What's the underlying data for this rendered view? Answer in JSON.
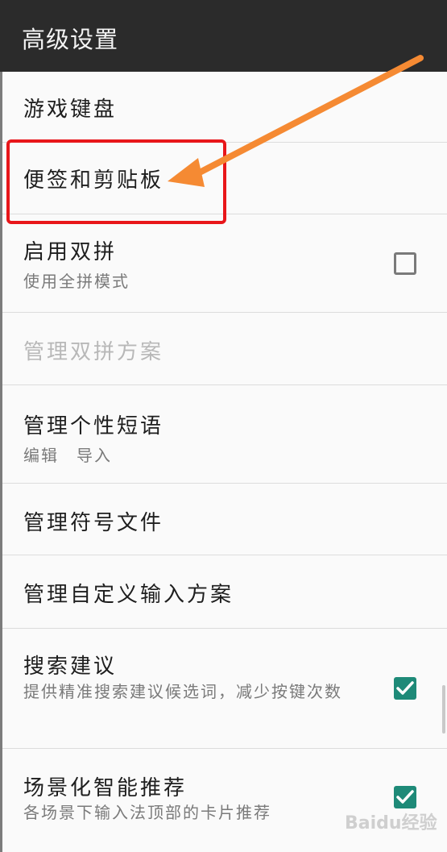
{
  "appbar": {
    "title": "高级设置"
  },
  "items": [
    {
      "title": "游戏键盘"
    },
    {
      "title": "便签和剪贴板"
    },
    {
      "title": "启用双拼",
      "subtitle": "使用全拼模式",
      "checked": false
    },
    {
      "title": "管理双拼方案",
      "disabled": true
    },
    {
      "title": "管理个性短语",
      "subtitle": "编辑　导入"
    },
    {
      "title": "管理符号文件"
    },
    {
      "title": "管理自定义输入方案"
    },
    {
      "title": "搜索建议",
      "subtitle": "提供精准搜索建议候选词，减少按键次数",
      "checked": true
    },
    {
      "title": "场景化智能推荐",
      "subtitle": "各场景下输入法顶部的卡片推荐",
      "checked": true
    }
  ],
  "colors": {
    "accent": "#1e8a78",
    "highlight": "#e8161a",
    "arrow": "#f58a33",
    "appbar": "#2b2b2b"
  },
  "icons": {
    "checkbox_checked": "check-icon",
    "arrow": "arrow-pointer-icon"
  },
  "watermark": "Baidu经验"
}
